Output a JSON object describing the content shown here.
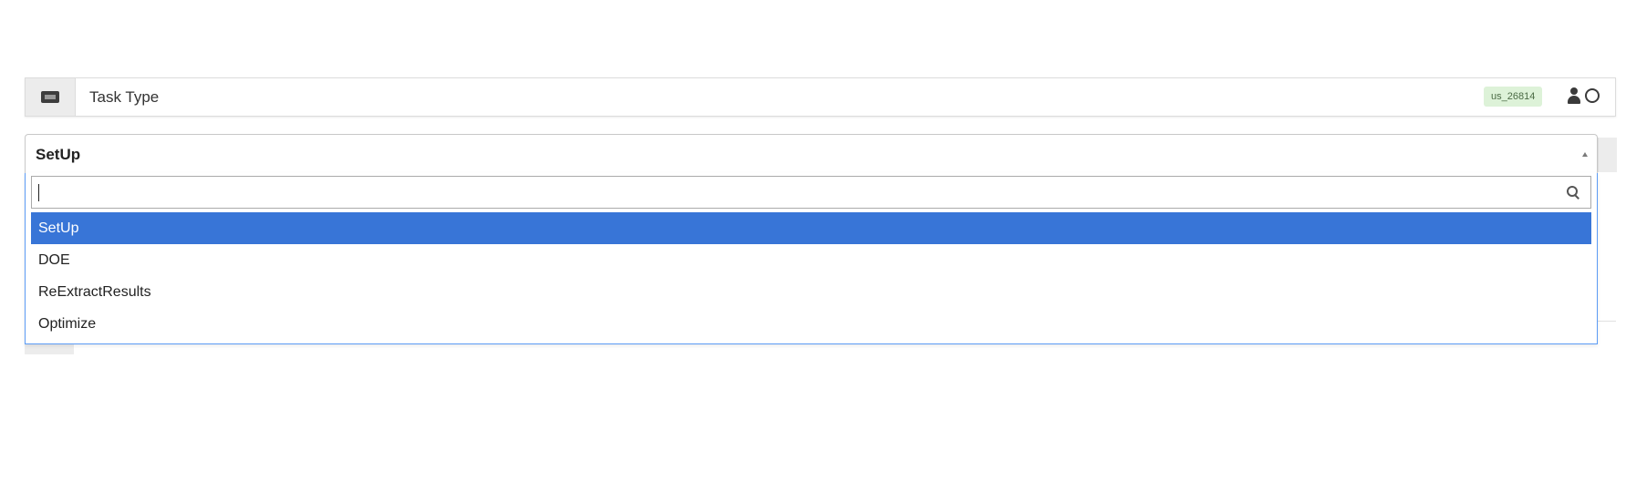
{
  "task_row": {
    "label": "Task Type",
    "user_badge": "us_26814",
    "icons": [
      "id-card-icon",
      "person-icon",
      "clock-icon"
    ]
  },
  "select": {
    "selected_value": "SetUp",
    "search_value": "",
    "options": [
      {
        "label": "SetUp",
        "highlighted": true
      },
      {
        "label": "DOE",
        "highlighted": false
      },
      {
        "label": "ReExtractResults",
        "highlighted": false
      },
      {
        "label": "Optimize",
        "highlighted": false
      }
    ]
  },
  "colors": {
    "highlight": "#3875d7",
    "panel_border": "#5b9bf5",
    "badge_bg": "#ddf2d8",
    "icon_cell_bg": "#ececec"
  }
}
